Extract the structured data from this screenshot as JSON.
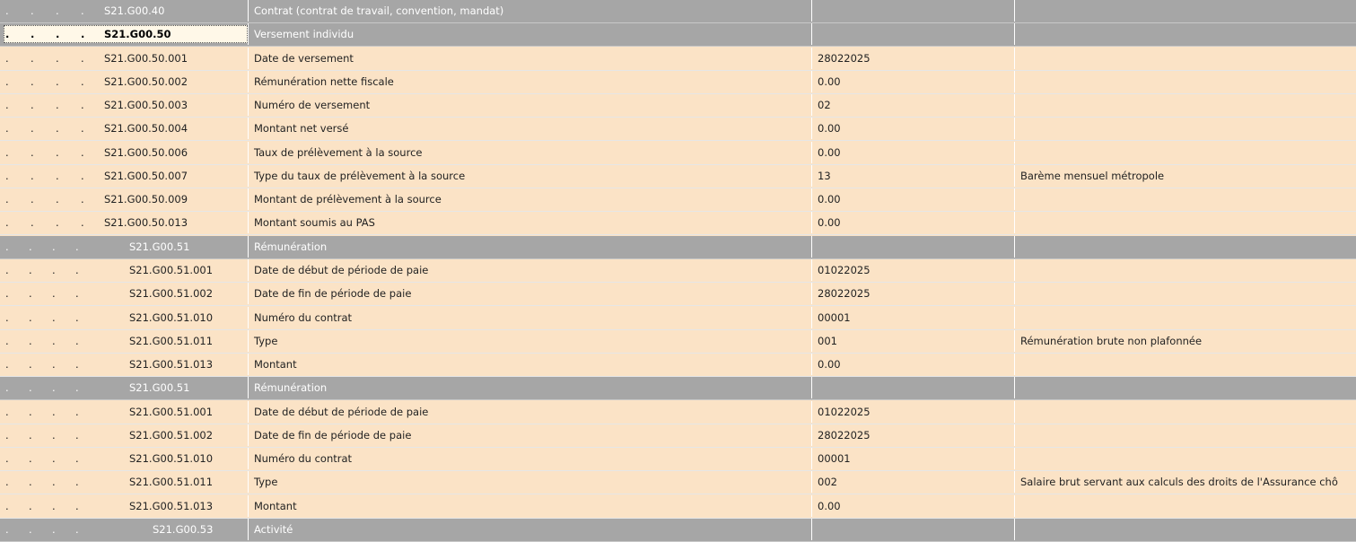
{
  "rows": [
    {
      "level": 4,
      "code": "S21.G00.40",
      "label": "Contrat (contrat de travail, convention, mandat)",
      "value": "",
      "desc": "",
      "type": "group"
    },
    {
      "level": 4,
      "code": "S21.G00.50",
      "label": "Versement individu",
      "value": "",
      "desc": "",
      "type": "group",
      "selected": true
    },
    {
      "level": 4,
      "code": "S21.G00.50.001",
      "label": "Date de versement",
      "value": "28022025",
      "desc": ""
    },
    {
      "level": 4,
      "code": "S21.G00.50.002",
      "label": "Rémunération nette fiscale",
      "value": "0.00",
      "desc": ""
    },
    {
      "level": 4,
      "code": "S21.G00.50.003",
      "label": "Numéro de versement",
      "value": "02",
      "desc": ""
    },
    {
      "level": 4,
      "code": "S21.G00.50.004",
      "label": "Montant net versé",
      "value": "0.00",
      "desc": ""
    },
    {
      "level": 4,
      "code": "S21.G00.50.006",
      "label": "Taux de prélèvement à la source",
      "value": "0.00",
      "desc": ""
    },
    {
      "level": 4,
      "code": "S21.G00.50.007",
      "label": "Type du taux de prélèvement à la source",
      "value": "13",
      "desc": "Barème mensuel métropole"
    },
    {
      "level": 4,
      "code": "S21.G00.50.009",
      "label": "Montant de prélèvement à la source",
      "value": "0.00",
      "desc": ""
    },
    {
      "level": 4,
      "code": "S21.G00.50.013",
      "label": "Montant soumis au PAS",
      "value": "0.00",
      "desc": ""
    },
    {
      "level": 5,
      "code": "S21.G00.51",
      "label": "Rémunération",
      "value": "",
      "desc": "",
      "type": "group"
    },
    {
      "level": 5,
      "code": "S21.G00.51.001",
      "label": "Date de début de période de paie",
      "value": "01022025",
      "desc": ""
    },
    {
      "level": 5,
      "code": "S21.G00.51.002",
      "label": "Date de fin de période de paie",
      "value": "28022025",
      "desc": ""
    },
    {
      "level": 5,
      "code": "S21.G00.51.010",
      "label": "Numéro du contrat",
      "value": "00001",
      "desc": ""
    },
    {
      "level": 5,
      "code": "S21.G00.51.011",
      "label": "Type",
      "value": "001",
      "desc": "Rémunération brute non plafonnée"
    },
    {
      "level": 5,
      "code": "S21.G00.51.013",
      "label": "Montant",
      "value": "0.00",
      "desc": ""
    },
    {
      "level": 5,
      "code": "S21.G00.51",
      "label": "Rémunération",
      "value": "",
      "desc": "",
      "type": "group"
    },
    {
      "level": 5,
      "code": "S21.G00.51.001",
      "label": "Date de début de période de paie",
      "value": "01022025",
      "desc": ""
    },
    {
      "level": 5,
      "code": "S21.G00.51.002",
      "label": "Date de fin de période de paie",
      "value": "28022025",
      "desc": ""
    },
    {
      "level": 5,
      "code": "S21.G00.51.010",
      "label": "Numéro du contrat",
      "value": "00001",
      "desc": ""
    },
    {
      "level": 5,
      "code": "S21.G00.51.011",
      "label": "Type",
      "value": "002",
      "desc": "Salaire brut servant aux calculs des droits de l'Assurance chô"
    },
    {
      "level": 5,
      "code": "S21.G00.51.013",
      "label": "Montant",
      "value": "0.00",
      "desc": ""
    },
    {
      "level": 6,
      "code": "S21.G00.53",
      "label": "Activité",
      "value": "",
      "desc": "",
      "type": "group"
    }
  ],
  "colors": {
    "row_background": "#fbe3c6",
    "group_background": "#a6a6a6",
    "group_text": "#ffffff",
    "row_text": "#222222"
  }
}
